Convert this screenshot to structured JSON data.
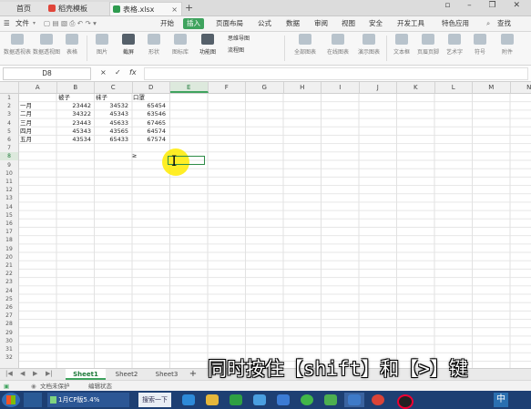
{
  "tabs": {
    "home": "首页",
    "template": "稻壳模板",
    "file": "表格.xlsx",
    "new_tab": "+"
  },
  "menubar": {
    "file_menu": "文件",
    "items": [
      "开始",
      "插入",
      "页面布局",
      "公式",
      "数据",
      "审阅",
      "视图",
      "安全",
      "开发工具",
      "特色应用"
    ],
    "active_index": 1,
    "search": "查找"
  },
  "ribbon": {
    "buttons": [
      "数据透视表",
      "数据透视图",
      "表格",
      "图片",
      "截屏",
      "形状",
      "图标库",
      "功能图",
      "思维导图",
      "流程图",
      "全部图表",
      "在线图表",
      "演示图表",
      "文本框",
      "页眉页脚",
      "艺术字",
      "符号",
      "附件"
    ],
    "dark_indices": [
      4,
      7,
      8,
      9
    ]
  },
  "formula_bar": {
    "cell_ref": "D8",
    "cancel_icon": "×",
    "confirm_icon": "✓",
    "fx_label": "fx",
    "value": ""
  },
  "columns": [
    "A",
    "B",
    "C",
    "D",
    "E",
    "F",
    "G",
    "H",
    "I",
    "J",
    "K",
    "L",
    "M",
    "N"
  ],
  "rows": [
    "1",
    "2",
    "3",
    "4",
    "5",
    "6",
    "7",
    "8",
    "9",
    "10",
    "11",
    "12",
    "13",
    "14",
    "15",
    "16",
    "17",
    "18",
    "19",
    "20",
    "21",
    "22",
    "23",
    "24",
    "25",
    "26",
    "27",
    "28",
    "29",
    "30",
    "31",
    "32"
  ],
  "selected": {
    "column": "E",
    "row": "8"
  },
  "table": {
    "headers": [
      "被子",
      "袜子",
      "口罩"
    ],
    "months": [
      "一月",
      "二月",
      "三月",
      "四月",
      "五月"
    ],
    "values": [
      [
        23442,
        34532,
        65454
      ],
      [
        34322,
        45343,
        63546
      ],
      [
        23443,
        45633,
        67465
      ],
      [
        45343,
        43565,
        64574
      ],
      [
        43534,
        65433,
        67574
      ]
    ],
    "d8_symbol": "≥"
  },
  "sheets": {
    "tabs": [
      "Sheet1",
      "Sheet2",
      "Sheet3"
    ],
    "active": "Sheet1",
    "add": "+"
  },
  "status": {
    "protect": "文档未保护",
    "mode": "编辑状态"
  },
  "caption": "同时按住【shift】和【>】键",
  "taskbar": {
    "perf_label": "1月CP版5.4%",
    "search_label": "搜索一下",
    "ime_label": "中"
  },
  "colors": {
    "accent": "#3fa35e",
    "taskbar": "#1d3f73",
    "highlight": "#ffeb00"
  }
}
